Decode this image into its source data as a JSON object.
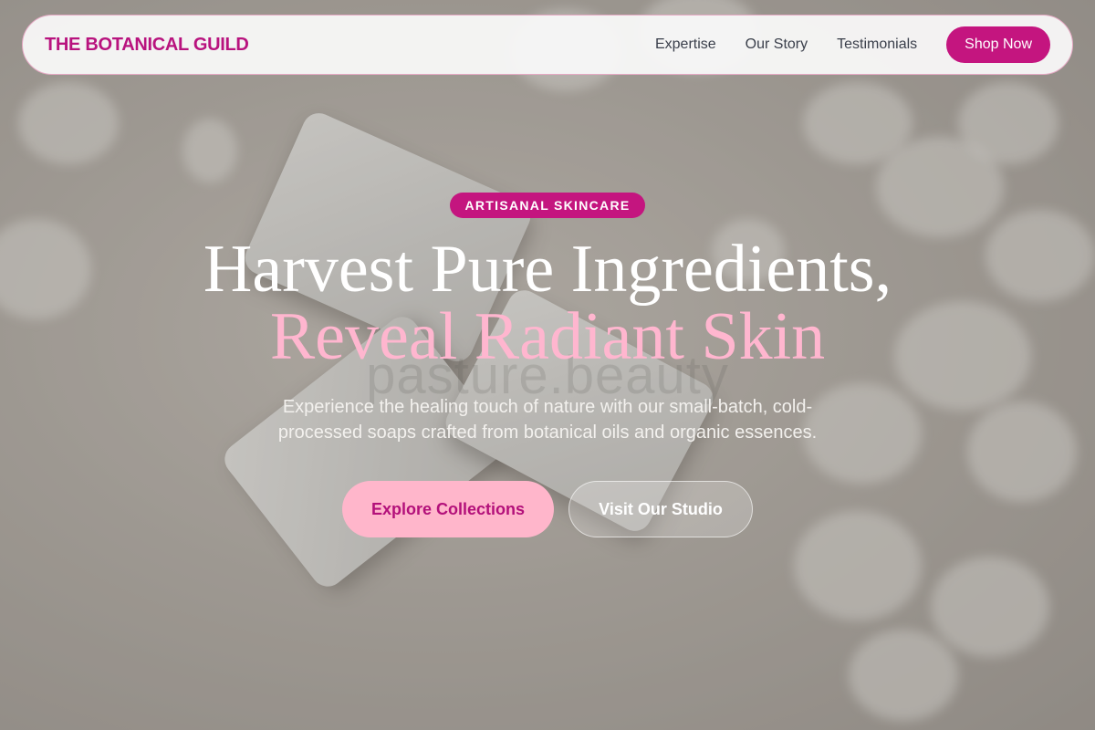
{
  "nav": {
    "brand": "THE BOTANICAL GUILD",
    "links": [
      "Expertise",
      "Our Story",
      "Testimonials"
    ],
    "cta_label": "Shop Now"
  },
  "hero": {
    "badge": "ARTISANAL SKINCARE",
    "headline_line1": "Harvest Pure Ingredients,",
    "headline_line2": "Reveal Radiant Skin",
    "subtitle": "Experience the healing touch of nature with our small-batch, cold-processed soaps crafted from botanical oils and organic essences.",
    "primary_button": "Explore Collections",
    "secondary_button": "Visit Our Studio",
    "watermark": "pasture.beauty"
  },
  "colors": {
    "brand": "#b8137e",
    "cta_background": "#c4157f",
    "highlight_pink": "#ffb6cf",
    "primary_button_bg": "#ffb6cb"
  }
}
